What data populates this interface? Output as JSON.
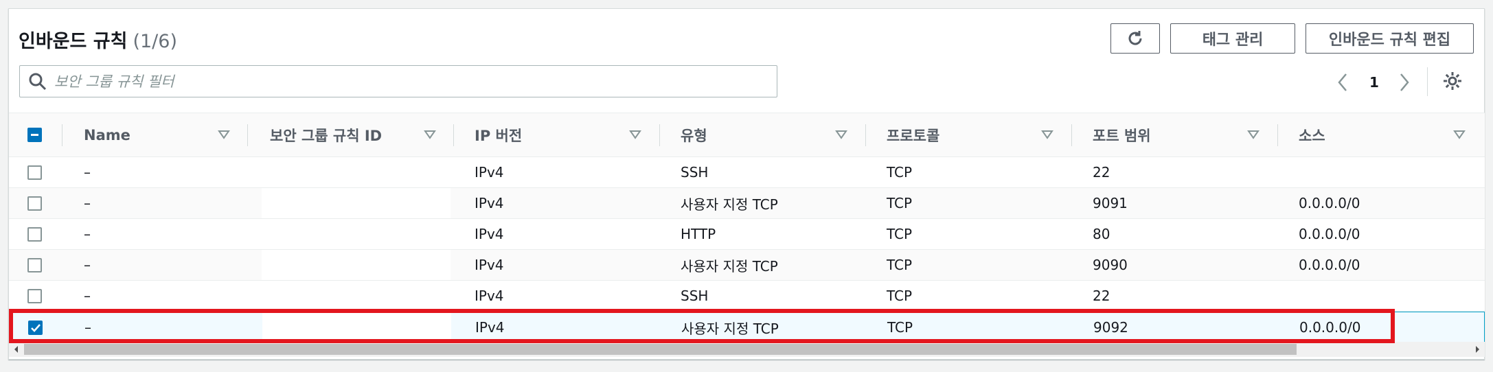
{
  "header": {
    "title": "인바운드 규칙",
    "count": "(1/6)",
    "refresh_icon": "refresh-icon",
    "manage_tags_label": "태그 관리",
    "edit_rules_label": "인바운드 규칙 편집"
  },
  "search": {
    "placeholder": "보안 그룹 규칙 필터",
    "value": ""
  },
  "pagination": {
    "current_page": "1"
  },
  "table": {
    "columns": [
      {
        "label": "Name"
      },
      {
        "label": "보안 그룹 규칙 ID"
      },
      {
        "label": "IP 버전"
      },
      {
        "label": "유형"
      },
      {
        "label": "프로토콜"
      },
      {
        "label": "포트 범위"
      },
      {
        "label": "소스"
      }
    ],
    "rows": [
      {
        "name": "–",
        "ip": "IPv4",
        "type": "SSH",
        "protocol": "TCP",
        "port": "22",
        "source": "",
        "selected": false
      },
      {
        "name": "–",
        "ip": "IPv4",
        "type": "사용자 지정 TCP",
        "protocol": "TCP",
        "port": "9091",
        "source": "0.0.0.0/0",
        "selected": false
      },
      {
        "name": "–",
        "ip": "IPv4",
        "type": "HTTP",
        "protocol": "TCP",
        "port": "80",
        "source": "0.0.0.0/0",
        "selected": false
      },
      {
        "name": "–",
        "ip": "IPv4",
        "type": "사용자 지정 TCP",
        "protocol": "TCP",
        "port": "9090",
        "source": "0.0.0.0/0",
        "selected": false
      },
      {
        "name": "–",
        "ip": "IPv4",
        "type": "SSH",
        "protocol": "TCP",
        "port": "22",
        "source": "",
        "selected": false
      },
      {
        "name": "–",
        "ip": "IPv4",
        "type": "사용자 지정 TCP",
        "protocol": "TCP",
        "port": "9092",
        "source": "0.0.0.0/0",
        "selected": true
      }
    ]
  },
  "colors": {
    "accent": "#0073bb",
    "selected_row_border": "#00a1c9",
    "highlight": "#e3161e"
  }
}
